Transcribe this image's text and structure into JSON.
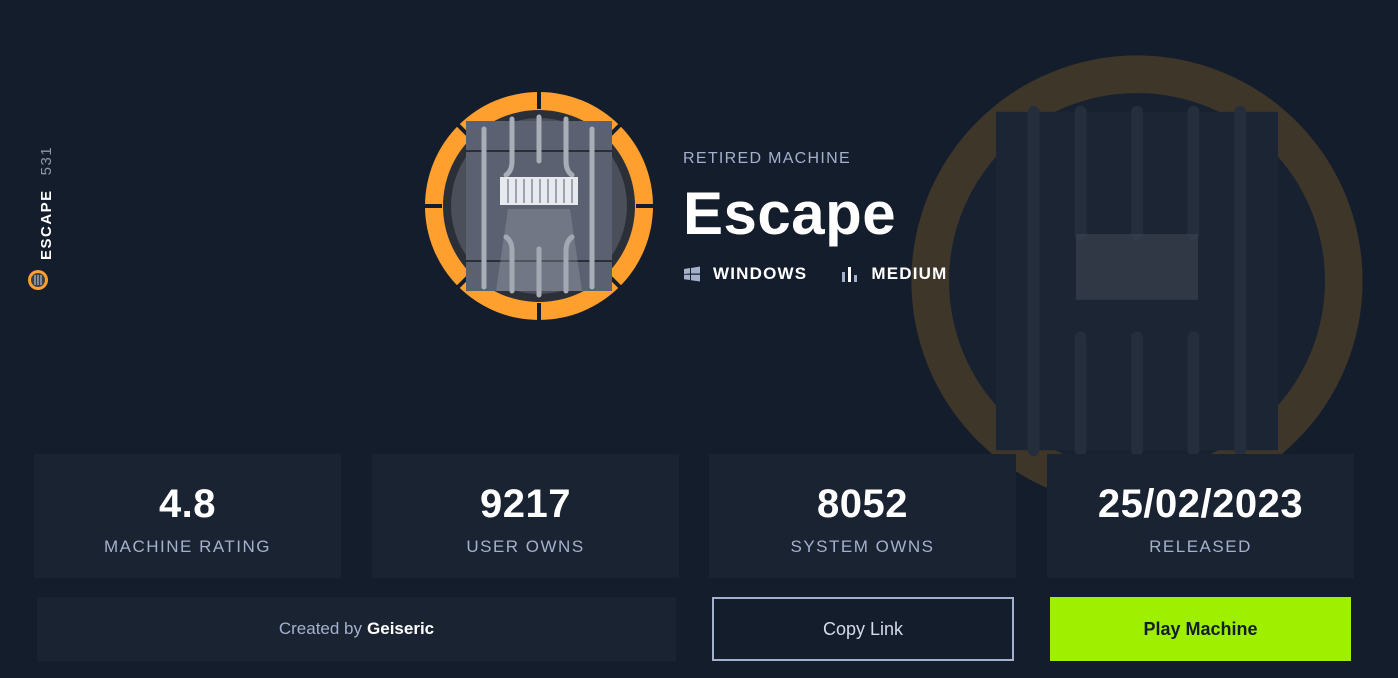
{
  "machine": {
    "side_name": "ESCAPE",
    "side_id": "531",
    "status": "RETIRED MACHINE",
    "name": "Escape",
    "os": "WINDOWS",
    "difficulty": "MEDIUM"
  },
  "stats": [
    {
      "value": "4.8",
      "label": "MACHINE RATING"
    },
    {
      "value": "9217",
      "label": "USER OWNS"
    },
    {
      "value": "8052",
      "label": "SYSTEM OWNS"
    },
    {
      "value": "25/02/2023",
      "label": "RELEASED"
    }
  ],
  "actions": {
    "created_by_prefix": "Created by",
    "creator_name": "Geiseric",
    "copy_link_label": "Copy Link",
    "play_label": "Play Machine"
  },
  "icons": {
    "os": "windows-icon",
    "difficulty": "bar-chart-icon",
    "side": "machine-avatar-icon"
  },
  "colors": {
    "background": "#141d2b",
    "card": "#1a2332",
    "accent_green": "#9fef00",
    "ring_orange": "#ff9f2e",
    "muted_text": "#a4b1cd"
  }
}
